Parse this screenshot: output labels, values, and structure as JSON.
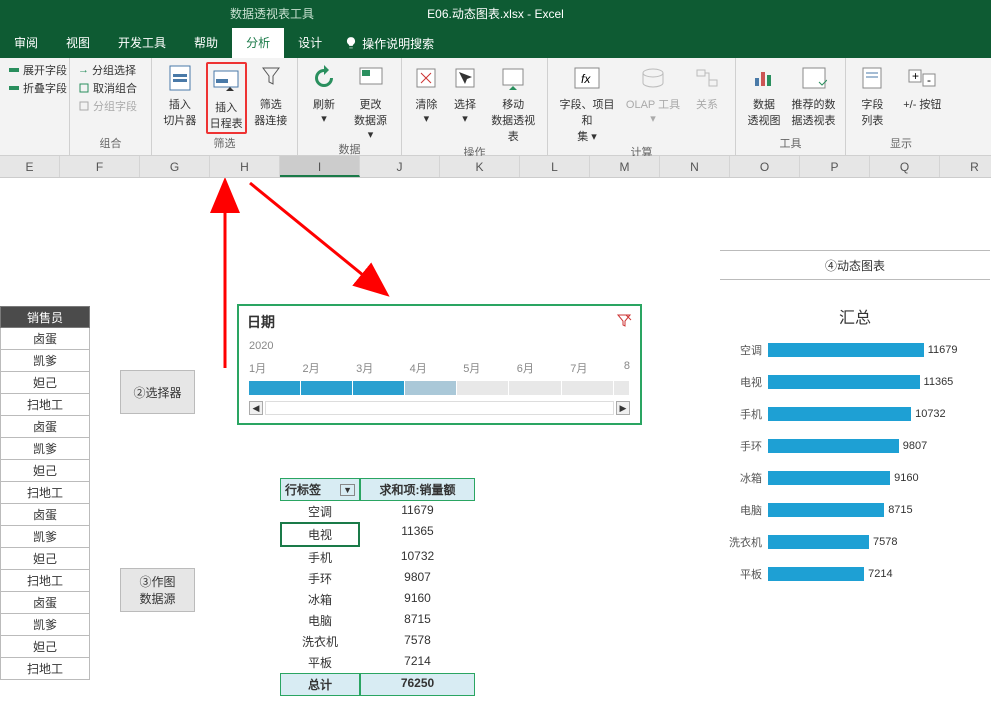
{
  "app_title": "E06.动态图表.xlsx - Excel",
  "context_tab": "数据透视表工具",
  "tabs": {
    "review": "审阅",
    "view": "视图",
    "dev": "开发工具",
    "help": "帮助",
    "analyze": "分析",
    "design": "设计",
    "tellme": "操作说明搜索"
  },
  "ribbon": {
    "field_group": {
      "expand": "展开字段",
      "collapse": "折叠字段"
    },
    "group_group": {
      "select": "分组选择",
      "cancel": "取消组合",
      "field": "分组字段",
      "label": "组合"
    },
    "filter_group": {
      "slicer1": "插入",
      "slicer2": "切片器",
      "tl1": "插入",
      "tl2": "日程表",
      "conn1": "筛选",
      "conn2": "器连接",
      "label": "筛选"
    },
    "data_group": {
      "refresh": "刷新",
      "change": "更改",
      "change2": "数据源",
      "label": "数据"
    },
    "action_group": {
      "clear": "清除",
      "select": "选择",
      "move1": "移动",
      "move2": "数据透视表",
      "label": "操作"
    },
    "calc_group": {
      "field1": "字段、项目和",
      "field2": "集",
      "olap": "OLAP 工具",
      "relation": "关系",
      "label": "计算"
    },
    "tool_group": {
      "chart1": "数据",
      "chart2": "透视图",
      "rec1": "推荐的数",
      "rec2": "据透视表",
      "label": "工具"
    },
    "show_group": {
      "list1": "字段",
      "list2": "列表",
      "btn": "+/- 按钮",
      "label": "显示"
    }
  },
  "columns": [
    "E",
    "F",
    "G",
    "H",
    "I",
    "J",
    "K",
    "L",
    "M",
    "N",
    "O",
    "P",
    "Q",
    "R"
  ],
  "sales_header": "销售员",
  "sales_names": [
    "卤蛋",
    "凯爹",
    "妲己",
    "扫地工",
    "卤蛋",
    "凯爹",
    "妲己",
    "扫地工",
    "卤蛋",
    "凯爹",
    "妲己",
    "扫地工",
    "卤蛋",
    "凯爹",
    "妲己",
    "扫地工"
  ],
  "selector_label": "②选择器",
  "source_label": "③作图\n数据源",
  "chart_box_label": "④动态图表",
  "timeline": {
    "title": "日期",
    "year": "2020",
    "months": [
      "1月",
      "2月",
      "3月",
      "4月",
      "5月",
      "6月",
      "7月",
      "8"
    ]
  },
  "pivot": {
    "h1": "行标签",
    "h2": "求和项:销量额",
    "rows": [
      {
        "label": "空调",
        "value": "11679"
      },
      {
        "label": "电视",
        "value": "11365"
      },
      {
        "label": "手机",
        "value": "10732"
      },
      {
        "label": "手环",
        "value": "9807"
      },
      {
        "label": "冰箱",
        "value": "9160"
      },
      {
        "label": "电脑",
        "value": "8715"
      },
      {
        "label": "洗衣机",
        "value": "7578"
      },
      {
        "label": "平板",
        "value": "7214"
      }
    ],
    "total_label": "总计",
    "total_value": "76250"
  },
  "chart_data": {
    "type": "bar",
    "title": "汇总",
    "categories": [
      "空调",
      "电视",
      "手机",
      "手环",
      "冰箱",
      "电脑",
      "洗衣机",
      "平板"
    ],
    "values": [
      11679,
      11365,
      10732,
      9807,
      9160,
      8715,
      7578,
      7214
    ],
    "xlim": [
      0,
      12000
    ]
  }
}
